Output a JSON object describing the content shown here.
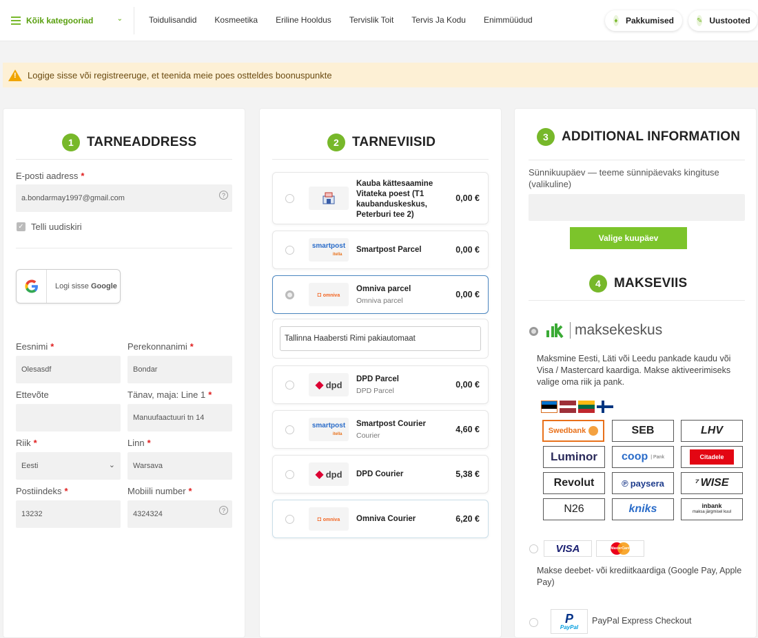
{
  "nav": {
    "categories_label": "Kõik kategooriad",
    "links": [
      "Toidulisandid",
      "Kosmeetika",
      "Eriline Hooldus",
      "Tervislik Toit",
      "Tervis Ja Kodu",
      "Enimmüüdud"
    ],
    "pill_offers": "Pakkumised",
    "pill_new": "Uustooted"
  },
  "notice": "Logige sisse või registreeruge, et teenida meie poes ostteldes boonuspunkte",
  "address": {
    "step": "1",
    "title": "TARNEADDRESS",
    "email_label": "E-posti aadress",
    "email_value": "a.bondarmay1997@gmail.com",
    "newsletter_label": "Telli uudiskiri",
    "google_label": "Logi sisse",
    "google_brand": "Google",
    "firstname_label": "Eesnimi",
    "firstname_value": "Olesasdf",
    "lastname_label": "Perekonnanimi",
    "lastname_value": "Bondar",
    "company_label": "Ettevõte",
    "company_value": "",
    "street_label": "Tänav, maja: Line 1",
    "street_value": "Manuufaactuuri tn 14",
    "country_label": "Riik",
    "country_value": "Eesti",
    "city_label": "Linn",
    "city_value": "Warsava",
    "postal_label": "Postiindeks",
    "postal_value": "13232",
    "phone_label": "Mobiili number",
    "phone_value": "4324324"
  },
  "shipping": {
    "step": "2",
    "title": "TARNEVIISID",
    "options": [
      {
        "name": "Kauba kättesaamine Vitateka poest (T1 kaubanduskeskus, Peterburi tee 2)",
        "sub": "",
        "price": "0,00 €",
        "logo": "store"
      },
      {
        "name": "Smartpost Parcel",
        "sub": "",
        "price": "0,00 €",
        "logo": "smartpost"
      },
      {
        "name": "Omniva parcel",
        "sub": "Omniva parcel",
        "price": "0,00 €",
        "logo": "omniva"
      },
      {
        "name": "DPD Parcel",
        "sub": "DPD Parcel",
        "price": "0,00 €",
        "logo": "dpd"
      },
      {
        "name": "Smartpost Courier",
        "sub": "Courier",
        "price": "4,60 €",
        "logo": "smartpost"
      },
      {
        "name": "DPD Courier",
        "sub": "",
        "price": "5,38 €",
        "logo": "dpd"
      },
      {
        "name": "Omniva Courier",
        "sub": "",
        "price": "6,20 €",
        "logo": "omniva"
      }
    ],
    "pickup_value": "Tallinna Haabersti Rimi pakiautomaat",
    "logo_texts": {
      "smartpost": "smartpost",
      "smartpost_sub": "itella",
      "omniva": "omniva",
      "dpd": "dpd"
    }
  },
  "additional": {
    "step": "3",
    "title": "ADDITIONAL INFORMATION",
    "birthday_label": "Sünnikuupäev — teeme sünnipäevaks kingituse (valikuline)",
    "date_button": "Valige kuupäev"
  },
  "payment": {
    "step": "4",
    "title": "MAKSEVIIS",
    "maksekeskus_brand": "maksekeskus",
    "maksekeskus_desc": "Maksmine Eesti, Läti või Leedu pankade kaudu või Visa / Mastercard kaardiga. Makse aktiveerimiseks valige oma riik ja pank.",
    "banks": [
      "Swedbank",
      "SEB",
      "LHV",
      "Luminor",
      "coop",
      "Citadele",
      "Revolut",
      "paysera",
      "WISE",
      "N26",
      "kniks",
      "inbank"
    ],
    "coop_sub": "Pank",
    "inbank_sub": "maksa järgmisel kuul",
    "card_visa": "VISA",
    "card_mc": "MasterCard",
    "card_desc": "Makse deebet- või krediitkaardiga (Google Pay, Apple Pay)",
    "paypal_logo": "PayPal",
    "paypal_label": "PayPal Express Checkout"
  }
}
